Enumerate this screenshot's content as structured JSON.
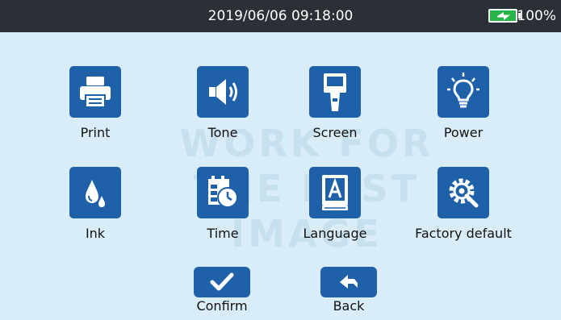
{
  "status_bar": {
    "datetime": "2019/06/06  09:18:00",
    "battery_level": "100%",
    "battery_icon": "battery-charging-icon"
  },
  "watermark": {
    "line1": "WORK FOR",
    "line2": "THE BEST IMAGE"
  },
  "menu": [
    {
      "id": "print",
      "label": "Print",
      "icon": "printer-icon"
    },
    {
      "id": "tone",
      "label": "Tone",
      "icon": "speaker-icon"
    },
    {
      "id": "screen",
      "label": "Screen",
      "icon": "handheld-screen-icon"
    },
    {
      "id": "power",
      "label": "Power",
      "icon": "lightbulb-icon"
    },
    {
      "id": "ink",
      "label": "Ink",
      "icon": "ink-drop-icon"
    },
    {
      "id": "time",
      "label": "Time",
      "icon": "calendar-clock-icon"
    },
    {
      "id": "language",
      "label": "Language",
      "icon": "language-book-icon"
    },
    {
      "id": "factory_default",
      "label": "Factory default",
      "icon": "gear-wrench-icon"
    }
  ],
  "actions": {
    "confirm_label": "Confirm",
    "back_label": "Back"
  },
  "colors": {
    "background": "#d8edf7",
    "status_bar": "#2b3036",
    "icon_tile": "#1f61a8",
    "battery_fill": "#29b449"
  }
}
